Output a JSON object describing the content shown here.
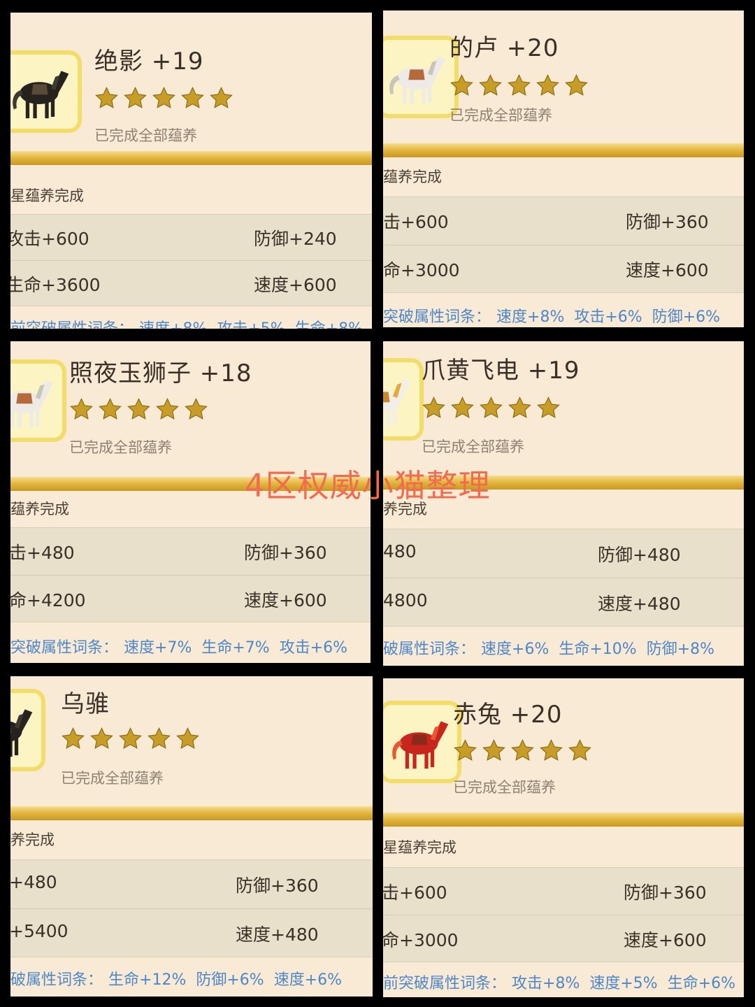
{
  "watermark": "4区权威小猫整理",
  "colors": {
    "card_background": "#f8ead5",
    "stat_background": "#e9e0cc",
    "gold_bar": "#e2b53c",
    "star_fill": "#c79d28",
    "bonus_text": "#4d86c9",
    "watermark_text": "#f26b4e"
  },
  "cards": [
    {
      "title": "绝影 +19",
      "star_rating": 5,
      "status": "已完成全部蕴养",
      "section_label": "星蕴养完成",
      "stats": [
        "攻击+600",
        "防御+240",
        "生命+3600",
        "速度+600"
      ],
      "bonus_prefix": "前突破属性词条：",
      "bonuses": [
        "速度+8%",
        "攻击+5%",
        "生命+8%"
      ],
      "avatar_icon": "black-horse-icon"
    },
    {
      "title": "的卢 +20",
      "star_rating": 5,
      "status": "已完成全部蕴养",
      "section_label": "蕴养完成",
      "stats": [
        "击+600",
        "防御+360",
        "命+3000",
        "速度+600"
      ],
      "bonus_prefix": "突破属性词条：",
      "bonuses": [
        "速度+8%",
        "攻击+6%",
        "防御+6%"
      ],
      "avatar_icon": "white-horse-icon"
    },
    {
      "title": "照夜玉狮子 +18",
      "star_rating": 5,
      "status": "已完成全部蕴养",
      "section_label": "蕴养完成",
      "stats": [
        "击+480",
        "防御+360",
        "命+4200",
        "速度+600"
      ],
      "bonus_prefix": "突破属性词条：",
      "bonuses": [
        "速度+7%",
        "生命+7%",
        "攻击+6%"
      ],
      "avatar_icon": "white-horse-icon"
    },
    {
      "title": "爪黄飞电 +19",
      "star_rating": 5,
      "status": "已完成全部蕴养",
      "section_label": "养完成",
      "stats": [
        "480",
        "防御+480",
        "4800",
        "速度+480"
      ],
      "bonus_prefix": "破属性词条：",
      "bonuses": [
        "速度+6%",
        "生命+10%",
        "防御+8%"
      ],
      "avatar_icon": "golden-horse-icon"
    },
    {
      "title": "乌骓",
      "star_rating": 5,
      "status": "已完成全部蕴养",
      "section_label": "养完成",
      "stats": [
        "+480",
        "防御+360",
        "+5400",
        "速度+480"
      ],
      "bonus_prefix": "破属性词条：",
      "bonuses": [
        "生命+12%",
        "防御+6%",
        "速度+6%"
      ],
      "avatar_icon": "black-horse-icon"
    },
    {
      "title": "赤兔 +20",
      "star_rating": 5,
      "status": "已完成全部蕴养",
      "section_label": "星蕴养完成",
      "stats": [
        "击+600",
        "防御+360",
        "命+3000",
        "速度+600"
      ],
      "bonus_prefix": "前突破属性词条：",
      "bonuses": [
        "攻击+8%",
        "速度+5%",
        "生命+6%"
      ],
      "avatar_icon": "red-horse-icon"
    }
  ]
}
